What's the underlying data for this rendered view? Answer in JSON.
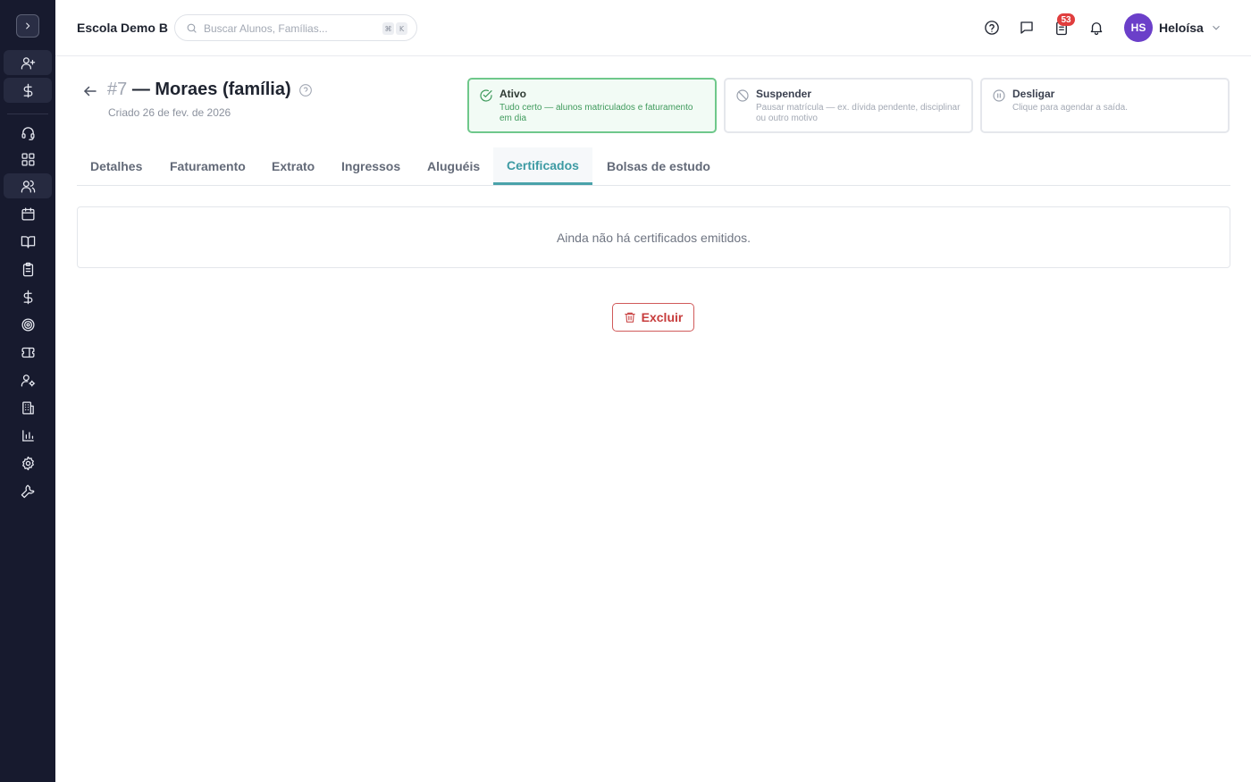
{
  "app": {
    "school_name": "Escola Demo B"
  },
  "search": {
    "placeholder": "Buscar Alunos, Famílias...",
    "shortcut_keys": [
      "⌘",
      "K"
    ]
  },
  "topbar": {
    "notifications_badge": "53",
    "user_initials": "HS",
    "user_name": "Heloísa",
    "avatar_color": "#6b3fc9"
  },
  "sidebar": {
    "items": [
      {
        "icon": "user-plus-icon"
      },
      {
        "icon": "dollar-icon"
      },
      {
        "icon": "headset-icon"
      },
      {
        "icon": "dashboard-icon"
      },
      {
        "icon": "users-icon"
      },
      {
        "icon": "calendar-icon"
      },
      {
        "icon": "book-icon"
      },
      {
        "icon": "clipboard-icon"
      },
      {
        "icon": "dollar-icon"
      },
      {
        "icon": "target-icon"
      },
      {
        "icon": "ticket-icon"
      },
      {
        "icon": "user-cog-icon"
      },
      {
        "icon": "building-icon"
      },
      {
        "icon": "bar-chart-icon"
      },
      {
        "icon": "gear-icon"
      },
      {
        "icon": "wrench-icon"
      }
    ]
  },
  "page": {
    "number": "#7",
    "title": "— Moraes (família)",
    "created": "Criado 26 de fev. de 2026"
  },
  "status": {
    "active": {
      "title": "Ativo",
      "desc": "Tudo certo — alunos matriculados e faturamento em dia"
    },
    "suspend": {
      "title": "Suspender",
      "desc": "Pausar matrícula — ex. dívida pendente, disciplinar ou outro motivo"
    },
    "disconnect": {
      "title": "Desligar",
      "desc": "Clique para agendar a saída."
    }
  },
  "tabs": [
    {
      "label": "Detalhes"
    },
    {
      "label": "Faturamento"
    },
    {
      "label": "Extrato"
    },
    {
      "label": "Ingressos"
    },
    {
      "label": "Aluguéis"
    },
    {
      "label": "Certificados",
      "active": true
    },
    {
      "label": "Bolsas de estudo"
    }
  ],
  "certificates": {
    "empty_message": "Ainda não há certificados emitidos."
  },
  "actions": {
    "delete_label": "Excluir"
  },
  "colors": {
    "sidebar_bg": "#171a2e",
    "accent": "#4aa2aa",
    "success": "#6fc88b",
    "danger": "#c73c3c"
  }
}
